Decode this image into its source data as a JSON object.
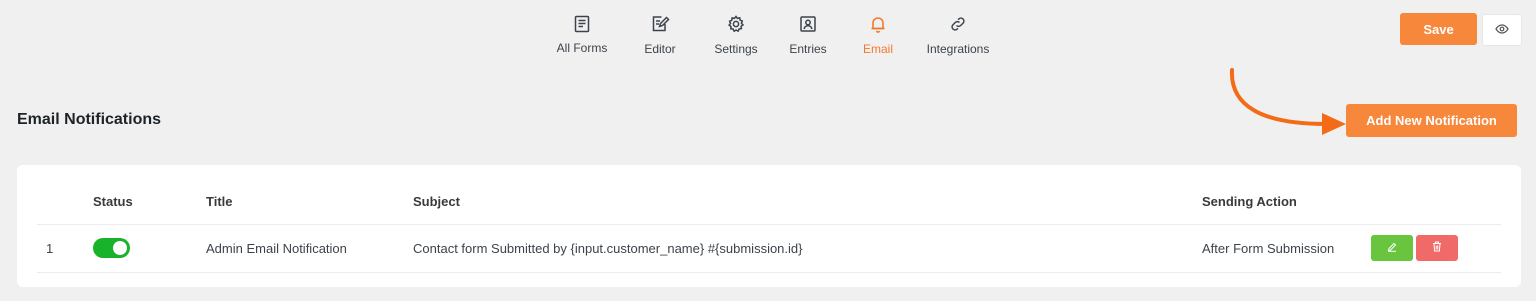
{
  "nav": {
    "items": [
      {
        "label": "All Forms",
        "icon": "forms-icon"
      },
      {
        "label": "Editor",
        "icon": "editor-icon"
      },
      {
        "label": "Settings",
        "icon": "gear-icon"
      },
      {
        "label": "Entries",
        "icon": "entries-icon"
      },
      {
        "label": "Email",
        "icon": "bell-icon",
        "active": true
      },
      {
        "label": "Integrations",
        "icon": "link-icon"
      }
    ],
    "active_color": "#f07a2c"
  },
  "header": {
    "save_label": "Save",
    "preview_icon": "eye-icon"
  },
  "section": {
    "title": "Email Notifications",
    "add_button_label": "Add New Notification"
  },
  "table": {
    "columns": [
      "Status",
      "Title",
      "Subject",
      "Sending Action"
    ],
    "rows": [
      {
        "index": "1",
        "enabled": true,
        "title": "Admin Email Notification",
        "subject": "Contact form Submitted by {input.customer_name} #{submission.id}",
        "sending_action": "After Form Submission"
      }
    ]
  },
  "colors": {
    "accent": "#f6873b",
    "toggle_on": "#18b32a",
    "edit": "#68c53d",
    "delete": "#f06a6a"
  }
}
